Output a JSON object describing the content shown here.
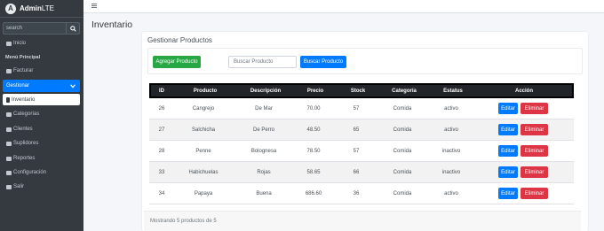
{
  "brand": {
    "logo_letter": "A",
    "name": "Admin",
    "suffix": "LTE"
  },
  "sidebar": {
    "search_placeholder": "search",
    "header": "Menú Principal",
    "items": [
      {
        "label": "Inicio",
        "icon": "home-icon"
      },
      {
        "label": "Facturar",
        "icon": "cart-icon"
      },
      {
        "label": "Gestionar",
        "icon": "chevron-down-icon"
      },
      {
        "label": "Inventario",
        "icon": "clipboard-icon"
      },
      {
        "label": "Categorías",
        "icon": "list-icon"
      },
      {
        "label": "Clientes",
        "icon": "users-icon"
      },
      {
        "label": "Suplidores",
        "icon": "truck-icon"
      },
      {
        "label": "Reportes",
        "icon": "chart-icon"
      },
      {
        "label": "Configuración",
        "icon": "gear-icon"
      },
      {
        "label": "Salir",
        "icon": "cart-icon"
      }
    ]
  },
  "page": {
    "title": "Inventario"
  },
  "card": {
    "title": "Gestionar Productos",
    "add_button": "Agregar Producto",
    "search_placeholder": "Buscar Producto",
    "search_button": "Buscar Producto"
  },
  "table": {
    "headers": [
      "ID",
      "Producto",
      "Descripción",
      "Precio",
      "Stock",
      "Categoría",
      "Estatus",
      "Acción"
    ],
    "rows": [
      [
        "26",
        "Cangrejo",
        "De Mar",
        "70.00",
        "57",
        "Comida",
        "activo"
      ],
      [
        "27",
        "Salchicha",
        "De Perro",
        "48.50",
        "65",
        "Comida",
        "activo"
      ],
      [
        "28",
        "Penne",
        "Bolognesa",
        "78.50",
        "57",
        "Comida",
        "inactivo"
      ],
      [
        "33",
        "Habichuelas",
        "Rojas",
        "58.65",
        "66",
        "Comida",
        "inactivo"
      ],
      [
        "34",
        "Papaya",
        "Buena",
        "686.60",
        "36",
        "Comida",
        "activo"
      ]
    ],
    "edit_label": "Editar",
    "delete_label": "Eliminar"
  },
  "footer": {
    "text": "Mostrando 5 productos de 5"
  },
  "colors": {
    "primary": "#007bff",
    "success": "#28a745",
    "danger": "#dc3545",
    "sidebar": "#343a40"
  }
}
